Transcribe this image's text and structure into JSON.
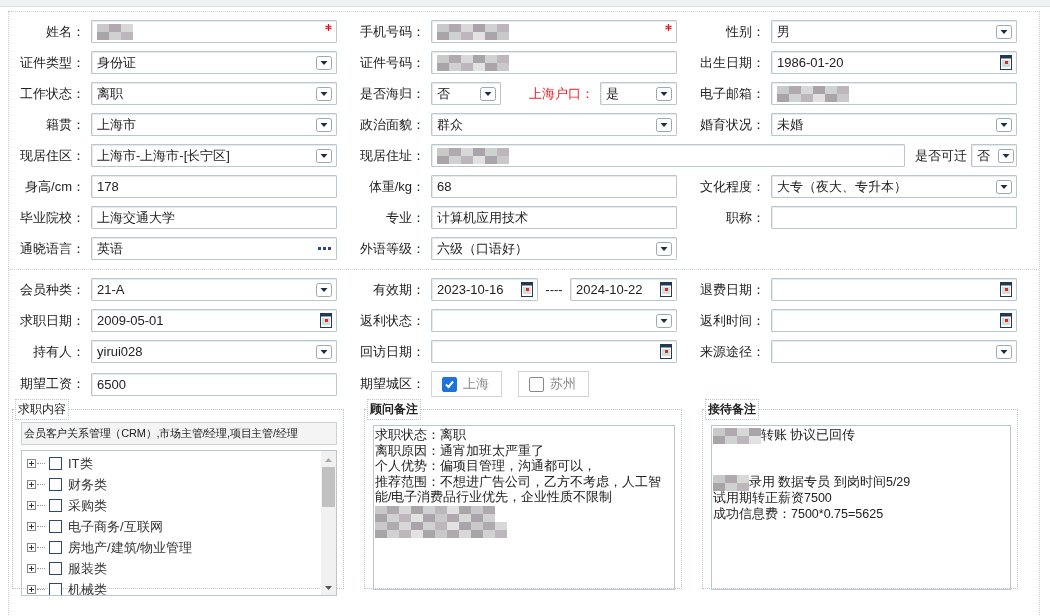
{
  "basic_rows": [
    [
      {
        "label": "姓名：",
        "kind": "text",
        "required": true,
        "redacted": true
      },
      {
        "label": "手机号码：",
        "kind": "text",
        "required": true,
        "redacted": true
      },
      {
        "label": "性别：",
        "kind": "select",
        "value": "男"
      }
    ],
    [
      {
        "label": "证件类型：",
        "kind": "select",
        "value": "身份证"
      },
      {
        "label": "证件号码：",
        "kind": "text",
        "required": false,
        "redacted": true
      },
      {
        "label": "出生日期：",
        "kind": "date",
        "value": "1986-01-20"
      }
    ],
    [
      {
        "label": "工作状态：",
        "kind": "select",
        "value": "离职"
      },
      {
        "label": "是否海归：",
        "kind": "select",
        "value": "否",
        "extra": {
          "label": "上海户口：",
          "highlighted": true,
          "value": "是"
        }
      },
      {
        "label": "电子邮箱：",
        "kind": "text",
        "required": false,
        "redacted": true
      }
    ],
    [
      {
        "label": "籍贯：",
        "kind": "select",
        "value": "上海市"
      },
      {
        "label": "政治面貌：",
        "kind": "select",
        "value": "群众"
      },
      {
        "label": "婚育状况：",
        "kind": "select",
        "value": "未婚"
      }
    ],
    [
      {
        "label": "现居住区：",
        "kind": "select",
        "value": "上海市-上海市-[长宁区]"
      },
      {
        "label": "现居住址：",
        "kind": "text",
        "wide": true,
        "required": false,
        "redacted": true,
        "extra": {
          "label": "是否可迁",
          "highlighted": false,
          "value": "否"
        }
      }
    ],
    [
      {
        "label": "身高/cm：",
        "kind": "text",
        "value": "178",
        "required": false,
        "redacted": false
      },
      {
        "label": "体重/kg：",
        "kind": "text",
        "value": "68",
        "required": false,
        "redacted": false
      },
      {
        "label": "文化程度：",
        "kind": "select",
        "value": "大专（夜大、专升本）"
      }
    ],
    [
      {
        "label": "毕业院校：",
        "kind": "text",
        "value": "上海交通大学",
        "required": false,
        "redacted": false
      },
      {
        "label": "专业：",
        "kind": "text",
        "value": "计算机应用技术",
        "required": false,
        "redacted": false
      },
      {
        "label": "职称：",
        "kind": "text",
        "required": false,
        "redacted": false
      }
    ],
    [
      {
        "label": "通晓语言：",
        "kind": "lookup",
        "value": "英语"
      },
      {
        "label": "外语等级：",
        "kind": "select",
        "value": "六级（口语好）"
      }
    ]
  ],
  "membership_rows": [
    [
      {
        "label": "会员种类：",
        "kind": "select",
        "value": "21-A"
      },
      {
        "label": "有效期：",
        "kind": "date_range",
        "from": "2023-10-16",
        "separator": "----",
        "to": "2024-10-22"
      },
      {
        "label": "退费日期：",
        "kind": "date"
      }
    ],
    [
      {
        "label": "求职日期：",
        "kind": "date",
        "value": "2009-05-01"
      },
      {
        "label": "返利状态：",
        "kind": "select"
      },
      {
        "label": "返利时间：",
        "kind": "date"
      }
    ],
    [
      {
        "label": "持有人：",
        "kind": "select",
        "value": "yirui028"
      },
      {
        "label": "回访日期：",
        "kind": "date"
      },
      {
        "label": "来源途径：",
        "kind": "select"
      }
    ],
    [
      {
        "label": "期望工资：",
        "kind": "text",
        "value": "6500",
        "required": false,
        "redacted": false
      },
      {
        "label": "期望城区：",
        "kind": "checkboxes",
        "options": [
          {
            "label": "上海",
            "checked": true
          },
          {
            "label": "苏州",
            "checked": false
          }
        ]
      }
    ]
  ],
  "job_panel": {
    "title": "求职内容",
    "selected_text": "会员客户关系管理（CRM）,市场主管/经理,项目主管/经理",
    "categories": [
      {
        "label": "IT类",
        "checked": false,
        "expanded": false
      },
      {
        "label": "财务类",
        "checked": false,
        "expanded": false
      },
      {
        "label": "采购类",
        "checked": false,
        "expanded": false
      },
      {
        "label": "电子商务/互联网",
        "checked": false,
        "expanded": false
      },
      {
        "label": "房地产/建筑/物业管理",
        "checked": false,
        "expanded": false
      },
      {
        "label": "服装类",
        "checked": false,
        "expanded": false
      },
      {
        "label": "机械类",
        "checked": false,
        "expanded": false
      }
    ]
  },
  "note_panels": [
    {
      "title": "顾问备注",
      "lines": [
        {
          "kind": "text",
          "text": "求职状态：离职",
          "redacted": false
        },
        {
          "kind": "text",
          "text": "离职原因：通宵加班太严重了",
          "redacted": false
        },
        {
          "kind": "text",
          "text": "个人优势：偏项目管理，沟通都可以，",
          "redacted": false
        },
        {
          "kind": "text",
          "text": "推荐范围：不想进广告公司，乙方不考虑，人工智能/电子消费品行业优先，企业性质不限制",
          "redacted": false
        },
        {
          "kind": "masked",
          "redacted": true
        },
        {
          "kind": "masked",
          "redacted": true
        }
      ]
    },
    {
      "title": "接待备注",
      "lines": [
        {
          "kind": "text",
          "text": "转账 协议已回传",
          "redacted": true
        },
        {
          "kind": "gap"
        },
        {
          "kind": "gap"
        },
        {
          "kind": "text",
          "text": "录用 数据专员 到岗时间5/29",
          "redacted": true
        },
        {
          "kind": "text",
          "text": "试用期转正薪资7500",
          "redacted": false
        },
        {
          "kind": "text",
          "text": "成功信息费：7500*0.75=5625",
          "redacted": false
        }
      ]
    }
  ]
}
